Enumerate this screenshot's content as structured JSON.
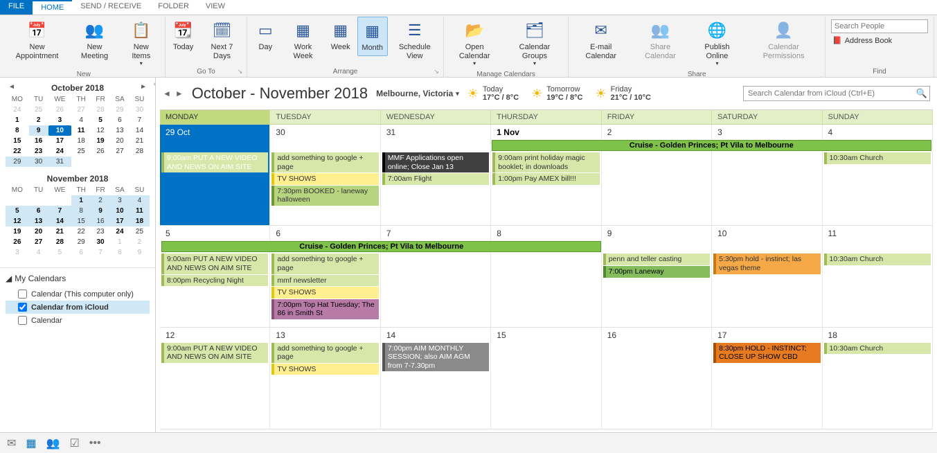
{
  "tabs": {
    "file": "FILE",
    "home": "HOME",
    "send": "SEND / RECEIVE",
    "folder": "FOLDER",
    "view": "VIEW"
  },
  "ribbon": {
    "new_appt": "New Appointment",
    "new_meet": "New Meeting",
    "new_items": "New Items",
    "new_group": "New",
    "today": "Today",
    "next7": "Next 7 Days",
    "goto_group": "Go To",
    "day": "Day",
    "work_week": "Work Week",
    "week": "Week",
    "month": "Month",
    "sched": "Schedule View",
    "arrange_group": "Arrange",
    "open_cal": "Open Calendar",
    "cal_groups": "Calendar Groups",
    "manage_group": "Manage Calendars",
    "email_cal": "E-mail Calendar",
    "share_cal": "Share Calendar",
    "publish": "Publish Online",
    "perms": "Calendar Permissions",
    "share_group": "Share",
    "search_ph": "Search People",
    "addr_book": "Address Book",
    "find_group": "Find"
  },
  "miniCals": [
    {
      "title": "October 2018",
      "dowRow": [
        "MO",
        "TU",
        "WE",
        "TH",
        "FR",
        "SA",
        "SU"
      ],
      "rows": [
        [
          {
            "n": 24,
            "dim": 1
          },
          {
            "n": 25,
            "dim": 1
          },
          {
            "n": 26,
            "dim": 1
          },
          {
            "n": 27,
            "dim": 1
          },
          {
            "n": 28,
            "dim": 1
          },
          {
            "n": 29,
            "dim": 1
          },
          {
            "n": 30,
            "dim": 1
          }
        ],
        [
          {
            "n": 1,
            "b": 1
          },
          {
            "n": 2,
            "b": 1
          },
          {
            "n": 3,
            "b": 1
          },
          {
            "n": 4
          },
          {
            "n": 5,
            "b": 1
          },
          {
            "n": 6
          },
          {
            "n": 7
          }
        ],
        [
          {
            "n": 8,
            "b": 1
          },
          {
            "n": 9,
            "b": 1,
            "hl": 1
          },
          {
            "n": 10,
            "b": 1,
            "today": 1
          },
          {
            "n": 11,
            "b": 1
          },
          {
            "n": 12
          },
          {
            "n": 13
          },
          {
            "n": 14
          }
        ],
        [
          {
            "n": 15,
            "b": 1
          },
          {
            "n": 16,
            "b": 1
          },
          {
            "n": 17,
            "b": 1
          },
          {
            "n": 18
          },
          {
            "n": 19,
            "b": 1
          },
          {
            "n": 20
          },
          {
            "n": 21
          }
        ],
        [
          {
            "n": 22,
            "b": 1
          },
          {
            "n": 23,
            "b": 1
          },
          {
            "n": 24,
            "b": 1
          },
          {
            "n": 25
          },
          {
            "n": 26
          },
          {
            "n": 27
          },
          {
            "n": 28
          }
        ],
        [
          {
            "n": 29,
            "hl": 1
          },
          {
            "n": 30,
            "hl": 1
          },
          {
            "n": 31,
            "hl": 1
          },
          {
            "n": "",
            "e": 1
          },
          {
            "n": "",
            "e": 1
          },
          {
            "n": "",
            "e": 1
          },
          {
            "n": "",
            "e": 1
          }
        ]
      ]
    },
    {
      "title": "November 2018",
      "dowRow": [
        "MO",
        "TU",
        "WE",
        "TH",
        "FR",
        "SA",
        "SU"
      ],
      "rows": [
        [
          {
            "n": "",
            "e": 1
          },
          {
            "n": "",
            "e": 1
          },
          {
            "n": "",
            "e": 1
          },
          {
            "n": 1,
            "b": 1,
            "hl": 1
          },
          {
            "n": 2,
            "hl": 1
          },
          {
            "n": 3,
            "hl": 1
          },
          {
            "n": 4,
            "hl": 1
          }
        ],
        [
          {
            "n": 5,
            "b": 1,
            "hl": 1
          },
          {
            "n": 6,
            "b": 1,
            "hl": 1
          },
          {
            "n": 7,
            "b": 1,
            "hl": 1
          },
          {
            "n": 8,
            "hl": 1
          },
          {
            "n": 9,
            "b": 1,
            "hl": 1
          },
          {
            "n": 10,
            "b": 1,
            "hl": 1
          },
          {
            "n": 11,
            "b": 1,
            "hl": 1
          }
        ],
        [
          {
            "n": 12,
            "b": 1,
            "hl": 1
          },
          {
            "n": 13,
            "b": 1,
            "hl": 1
          },
          {
            "n": 14,
            "b": 1,
            "hl": 1
          },
          {
            "n": 15,
            "hl": 1
          },
          {
            "n": 16,
            "hl": 1
          },
          {
            "n": 17,
            "b": 1,
            "hl": 1
          },
          {
            "n": 18,
            "b": 1,
            "hl": 1
          }
        ],
        [
          {
            "n": 19,
            "b": 1
          },
          {
            "n": 20,
            "b": 1
          },
          {
            "n": 21,
            "b": 1
          },
          {
            "n": 22
          },
          {
            "n": 23
          },
          {
            "n": 24,
            "b": 1
          },
          {
            "n": 25
          }
        ],
        [
          {
            "n": 26,
            "b": 1
          },
          {
            "n": 27,
            "b": 1
          },
          {
            "n": 28,
            "b": 1
          },
          {
            "n": 29
          },
          {
            "n": 30,
            "b": 1
          },
          {
            "n": 1,
            "dim": 1
          },
          {
            "n": 2,
            "dim": 1
          }
        ],
        [
          {
            "n": 3,
            "dim": 1
          },
          {
            "n": 4,
            "dim": 1
          },
          {
            "n": 5,
            "dim": 1
          },
          {
            "n": 6,
            "dim": 1
          },
          {
            "n": 7,
            "dim": 1
          },
          {
            "n": 8,
            "dim": 1
          },
          {
            "n": 9,
            "dim": 1
          }
        ]
      ]
    }
  ],
  "calList": {
    "header": "My Calendars",
    "items": [
      {
        "label": "Calendar (This computer only)",
        "checked": false
      },
      {
        "label": "Calendar from iCloud",
        "checked": true,
        "sel": true
      },
      {
        "label": "Calendar",
        "checked": false
      }
    ]
  },
  "calView": {
    "title": "October - November 2018",
    "location": "Melbourne, Victoria",
    "weather": [
      {
        "label": "Today",
        "temp": "17°C / 8°C"
      },
      {
        "label": "Tomorrow",
        "temp": "19°C / 8°C"
      },
      {
        "label": "Friday",
        "temp": "21°C / 10°C"
      }
    ],
    "searchPh": "Search Calendar from iCloud (Ctrl+E)",
    "dow": [
      "MONDAY",
      "TUESDAY",
      "WEDNESDAY",
      "THURSDAY",
      "FRIDAY",
      "SATURDAY",
      "SUNDAY"
    ]
  },
  "weeks": [
    {
      "span": {
        "text": "Cruise - Golden Princes; Pt Vila to Melbourne",
        "start": 3,
        "end": 7
      },
      "days": [
        {
          "num": "29 Oct",
          "selected": true,
          "events": [
            {
              "t": "9:00am PUT A NEW VIDEO AND NEWS ON AIM SITE",
              "c": "g1"
            }
          ]
        },
        {
          "num": "30",
          "events": [
            {
              "t": "add something to google + page",
              "c": "g1"
            },
            {
              "t": "TV SHOWS",
              "c": "yellow"
            },
            {
              "t": "7:30pm BOOKED - laneway halloween",
              "c": "g2"
            }
          ]
        },
        {
          "num": "31",
          "events": [
            {
              "t": "MMF Applications open online; Close Jan 13",
              "c": "dark"
            },
            {
              "t": "7:00am Flight",
              "c": "g1"
            }
          ]
        },
        {
          "num": "1 Nov",
          "today": true,
          "events": [
            {
              "t": "9:00am print holiday magic booklet; in downloads",
              "c": "g1"
            },
            {
              "t": "1:00pm Pay AMEX bill!!!",
              "c": "g1"
            }
          ]
        },
        {
          "num": "2",
          "events": []
        },
        {
          "num": "3",
          "events": []
        },
        {
          "num": "4",
          "events": [
            {
              "t": "10:30am Church",
              "c": "g1"
            }
          ]
        }
      ]
    },
    {
      "span": {
        "text": "Cruise - Golden Princes; Pt Vila to Melbourne",
        "start": 0,
        "end": 4
      },
      "days": [
        {
          "num": "5",
          "events": [
            {
              "t": "9:00am PUT A NEW VIDEO AND NEWS ON AIM SITE",
              "c": "g1"
            },
            {
              "t": "8:00pm Recycling Night",
              "c": "g1"
            }
          ]
        },
        {
          "num": "6",
          "events": [
            {
              "t": "add something to google + page",
              "c": "g1"
            },
            {
              "t": "mmf newsletter",
              "c": "g1"
            },
            {
              "t": "TV SHOWS",
              "c": "yellow"
            },
            {
              "t": "7:00pm Top Hat Tuesday; The 86 in Smith St",
              "c": "purple"
            }
          ]
        },
        {
          "num": "7",
          "events": []
        },
        {
          "num": "8",
          "events": []
        },
        {
          "num": "9",
          "events": [
            {
              "t": "penn and teller casting",
              "c": "g1"
            },
            {
              "t": "7:00pm Laneway",
              "c": "g3"
            }
          ]
        },
        {
          "num": "10",
          "events": [
            {
              "t": "5:30pm hold - instinct; las vegas theme",
              "c": "orange"
            }
          ]
        },
        {
          "num": "11",
          "events": [
            {
              "t": "10:30am Church",
              "c": "g1"
            }
          ]
        }
      ]
    },
    {
      "span": null,
      "days": [
        {
          "num": "12",
          "events": [
            {
              "t": "9:00am PUT A NEW VIDEO AND NEWS ON AIM SITE",
              "c": "g1"
            }
          ]
        },
        {
          "num": "13",
          "events": [
            {
              "t": "add something to google + page",
              "c": "g1"
            },
            {
              "t": "TV SHOWS",
              "c": "yellow"
            }
          ]
        },
        {
          "num": "14",
          "events": [
            {
              "t": "7:00pm AIM MONTHLY SESSION; also AIM AGM from 7-7.30pm",
              "c": "gray"
            }
          ]
        },
        {
          "num": "15",
          "events": []
        },
        {
          "num": "16",
          "events": []
        },
        {
          "num": "17",
          "events": [
            {
              "t": "8:30pm HOLD - INSTINCT; CLOSE UP SHOW CBD",
              "c": "darkorange"
            }
          ]
        },
        {
          "num": "18",
          "events": [
            {
              "t": "10:30am Church",
              "c": "g1"
            }
          ]
        }
      ]
    }
  ]
}
